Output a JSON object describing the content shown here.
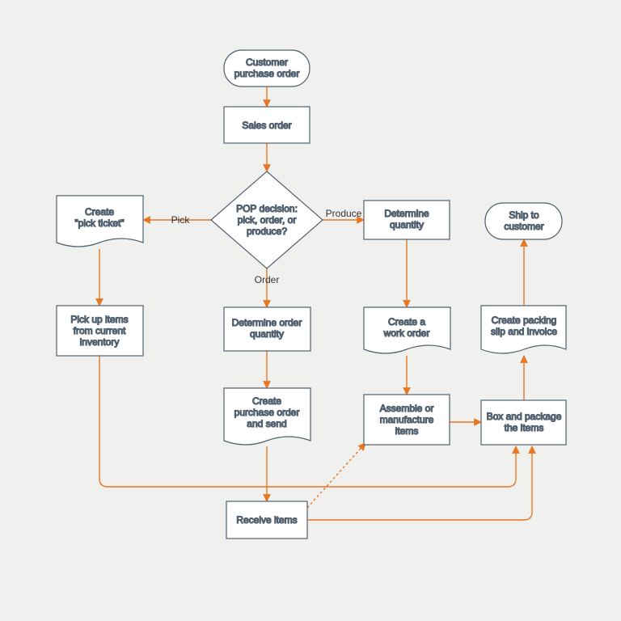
{
  "diagram": {
    "nodes": {
      "start": {
        "lines": [
          "Customer",
          "purchase order"
        ]
      },
      "sales": {
        "lines": [
          "Sales order"
        ]
      },
      "decision": {
        "lines": [
          "POP decision:",
          "pick, order, or",
          "produce?"
        ]
      },
      "pick_ticket": {
        "lines": [
          "Create",
          "\"pick ticket\""
        ]
      },
      "pick_items": {
        "lines": [
          "Pick up items",
          "from current",
          "inventory"
        ]
      },
      "det_order_qty": {
        "lines": [
          "Determine order",
          "quantity"
        ]
      },
      "create_po": {
        "lines": [
          "Create",
          "purchase order",
          "and send"
        ]
      },
      "receive": {
        "lines": [
          "Receive items"
        ]
      },
      "det_qty": {
        "lines": [
          "Determine",
          "quantity"
        ]
      },
      "work_order": {
        "lines": [
          "Create a",
          "work order"
        ]
      },
      "assemble": {
        "lines": [
          "Assemble or",
          "manufacture",
          "items"
        ]
      },
      "box": {
        "lines": [
          "Box and package",
          "the items"
        ]
      },
      "pack_slip": {
        "lines": [
          "Create packing",
          "slip and invoice"
        ]
      },
      "ship": {
        "lines": [
          "Ship to",
          "customer"
        ]
      }
    },
    "edge_labels": {
      "pick": "Pick",
      "order": "Order",
      "produce": "Produce"
    }
  }
}
